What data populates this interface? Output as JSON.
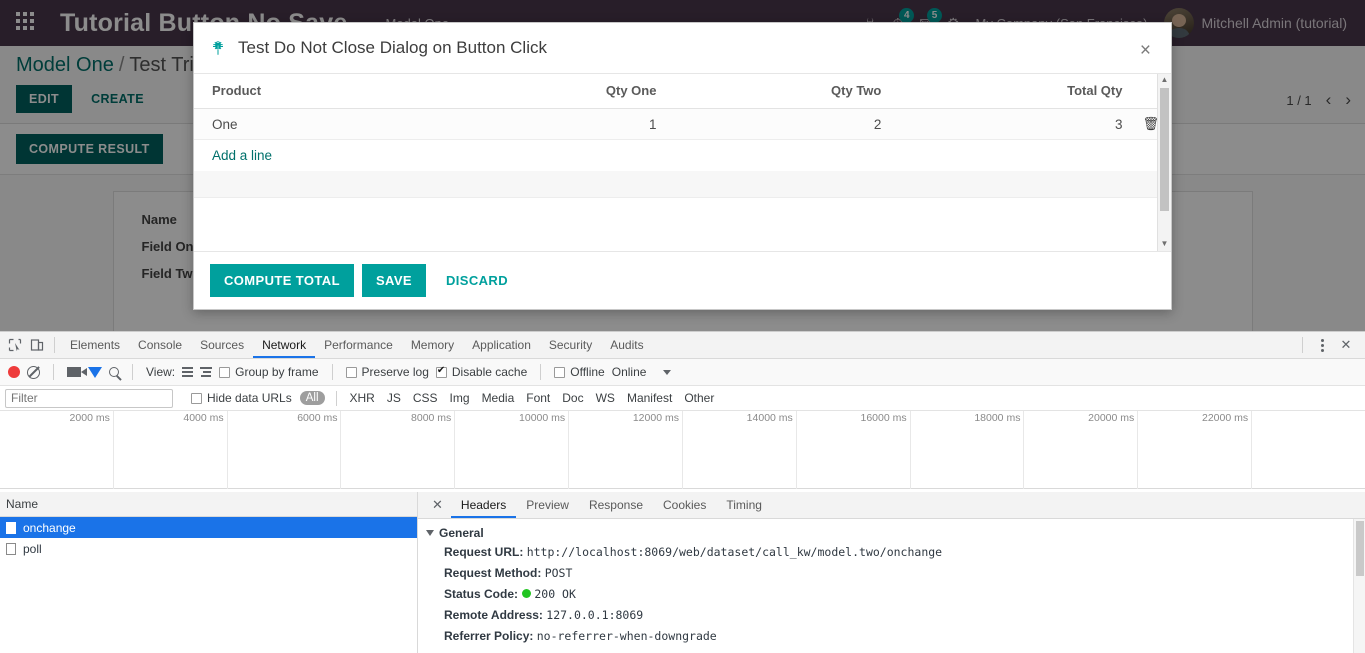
{
  "odoo": {
    "navbar": {
      "apps_icon": "apps-grid-icon",
      "brand": "Tutorial Button No Save",
      "menu_item": "Model One",
      "icons": [
        {
          "name": "bug-icon",
          "glyph": "☣",
          "badge": null
        },
        {
          "name": "activity-clock-icon",
          "glyph": "◴",
          "badge": "4"
        },
        {
          "name": "messages-icon",
          "glyph": "▬",
          "badge": "5"
        },
        {
          "name": "settings-gear-icon",
          "glyph": "⚙",
          "badge": null
        }
      ],
      "company": "My Company (San Francisco)",
      "user": "Mitchell Admin (tutorial)"
    },
    "breadcrumb": {
      "root": "Model One",
      "separator": "/",
      "current": "Test Trigger"
    },
    "buttons": {
      "edit": "EDIT",
      "create": "CREATE",
      "compute_result": "COMPUTE RESULT"
    },
    "pager": {
      "count": "1 / 1",
      "prev": "‹",
      "next": "›"
    },
    "form": {
      "rows": [
        {
          "label": "Name",
          "value": ""
        },
        {
          "label": "Field One",
          "value": ""
        },
        {
          "label": "Field Two",
          "value": ""
        }
      ]
    }
  },
  "dialog": {
    "icon": "bug-icon",
    "title": "Test Do Not Close Dialog on Button Click",
    "close_label": "×",
    "table": {
      "columns": [
        "Product",
        "Qty One",
        "Qty Two",
        "Total Qty"
      ],
      "rows": [
        {
          "product": "One",
          "qty_one": "1",
          "qty_two": "2",
          "total_qty": "3",
          "delete_icon": "trash-icon"
        }
      ],
      "add_line": "Add a line"
    },
    "footer": {
      "compute_total": "COMPUTE TOTAL",
      "save": "SAVE",
      "discard": "DISCARD"
    },
    "accent_color": "#00A09D"
  },
  "devtools": {
    "panels": [
      "Elements",
      "Console",
      "Sources",
      "Network",
      "Performance",
      "Memory",
      "Application",
      "Security",
      "Audits"
    ],
    "active_panel": "Network",
    "left_icons": [
      "inspect-element-icon",
      "device-toolbar-icon"
    ],
    "right_icons": [
      "kebab-menu-icon",
      "close-devtools-icon"
    ],
    "close_label": "✕",
    "toolbar": {
      "record_icon": "record-button-icon",
      "clear_icon": "clear-icon",
      "camera_icon": "capture-screenshots-icon",
      "filter_icon": "filter-icon",
      "search_icon": "search-icon",
      "view_label": "View:",
      "view_list_icon": "view-list-icon",
      "view_waterfall_icon": "view-waterfall-icon",
      "group_by_frame": {
        "label": "Group by frame",
        "checked": false
      },
      "preserve_log": {
        "label": "Preserve log",
        "checked": false
      },
      "disable_cache": {
        "label": "Disable cache",
        "checked": true
      },
      "offline": {
        "label": "Offline",
        "checked": false
      },
      "throttle": "Online",
      "throttle_caret": "chevron-down-icon"
    },
    "filterbar": {
      "filter_placeholder": "Filter",
      "filter_value": "",
      "hide_data_urls": {
        "label": "Hide data URLs",
        "checked": false
      },
      "types": [
        "All",
        "XHR",
        "JS",
        "CSS",
        "Img",
        "Media",
        "Font",
        "Doc",
        "WS",
        "Manifest",
        "Other"
      ],
      "active_type": "All"
    },
    "timeline": {
      "ticks": [
        "2000 ms",
        "4000 ms",
        "6000 ms",
        "8000 ms",
        "10000 ms",
        "12000 ms",
        "14000 ms",
        "16000 ms",
        "18000 ms",
        "20000 ms",
        "22000 ms",
        ""
      ]
    },
    "requests": {
      "column_header": "Name",
      "rows": [
        {
          "name": "onchange",
          "selected": true
        },
        {
          "name": "poll",
          "selected": false
        }
      ]
    },
    "detail": {
      "tabs": [
        "Headers",
        "Preview",
        "Response",
        "Cookies",
        "Timing"
      ],
      "active_tab": "Headers",
      "close_label": "✕",
      "section_title": "General",
      "headers": [
        {
          "key": "Request URL:",
          "value": "http://localhost:8069/web/dataset/call_kw/model.two/onchange",
          "status": null
        },
        {
          "key": "Request Method:",
          "value": "POST",
          "status": null
        },
        {
          "key": "Status Code:",
          "value": "200 OK",
          "status": "green"
        },
        {
          "key": "Remote Address:",
          "value": "127.0.0.1:8069",
          "status": null
        },
        {
          "key": "Referrer Policy:",
          "value": "no-referrer-when-downgrade",
          "status": null
        }
      ]
    }
  }
}
